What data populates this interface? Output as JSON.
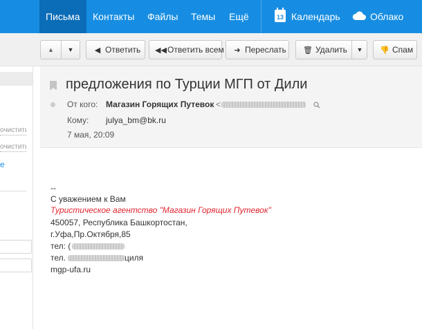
{
  "topnav": {
    "mail": "Письма",
    "contacts": "Контакты",
    "files": "Файлы",
    "themes": "Темы",
    "more": "Ещё",
    "calendar": "Календарь",
    "calendar_day": "13",
    "cloud": "Облако"
  },
  "toolbar": {
    "reply": "Ответить",
    "reply_all": "Ответить всем",
    "forward": "Переслать",
    "delete": "Удалить",
    "spam": "Спам"
  },
  "leftpane": {
    "clear_1": "очистить",
    "clear_2": "очистить",
    "link": "е"
  },
  "message": {
    "subject": "предложения по Турции МГП от Дили",
    "from_label": "От кого:",
    "from_name": "Магазин Горящих Путевок",
    "from_lt": "<",
    "to_label": "Кому:",
    "to_value": "julya_bm@bk.ru",
    "date": "7 мая, 20:09"
  },
  "body": {
    "line1": "--",
    "line2": "С уважением к Вам",
    "line3": "Туристическое агентство \"Магазин Горящих Путевок\"",
    "line4": "450057, Республика Башкортостан,",
    "line5": "г.Уфа,Пр.Октября,85",
    "line6": "тел: (",
    "line7": "тел.",
    "line7_suffix": "циля",
    "line8": "mgp-ufa.ru"
  },
  "colors": {
    "nav_bg": "#168de2",
    "nav_active": "#0b6cb8",
    "signature_red": "#e0252f"
  }
}
